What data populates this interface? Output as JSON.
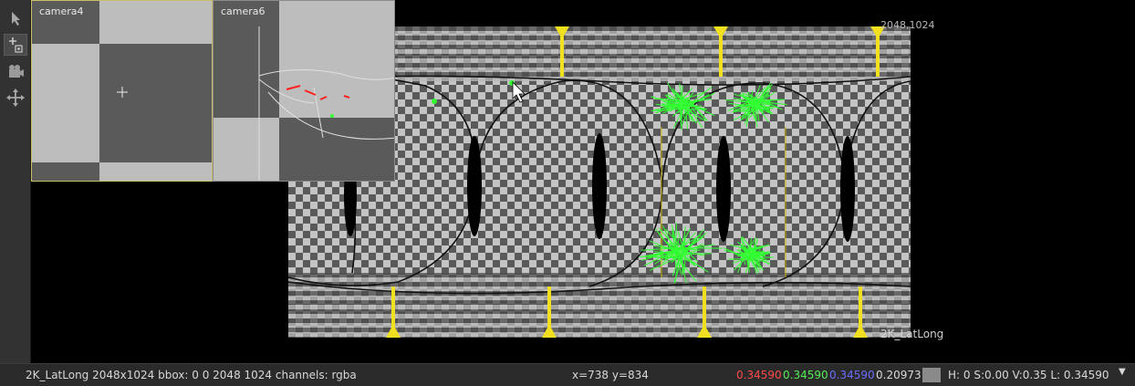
{
  "toolbar": {
    "tools": [
      {
        "name": "select-pointer-tool",
        "icon": "arrow-pointer-icon"
      },
      {
        "name": "add-marker-tool",
        "icon": "plus-marker-icon"
      },
      {
        "name": "camera-tool",
        "icon": "camera-icon"
      },
      {
        "name": "transform-move-tool",
        "icon": "move-arrows-icon"
      }
    ]
  },
  "viewer": {
    "image_format_label": "2048,1024",
    "image_name_label": "2K_LatLong",
    "camera_overlays": [
      {
        "title": "camera4"
      },
      {
        "title": "camera6"
      }
    ]
  },
  "status": {
    "image_info": "2K_LatLong 2048x1024  bbox: 0 0 2048 1024 channels: rgba",
    "cursor_pos": "x=738 y=834",
    "red": "0.34590",
    "green": "0.34590",
    "blue": "0.34590",
    "alpha": "0.20973",
    "hsvl": "H:   0 S:0.00 V:0.35  L: 0.34590",
    "swatch_color": "#8a8a8a",
    "red_color": "#ff4a4a",
    "green_color": "#55ee55",
    "blue_color": "#6a6aff"
  }
}
